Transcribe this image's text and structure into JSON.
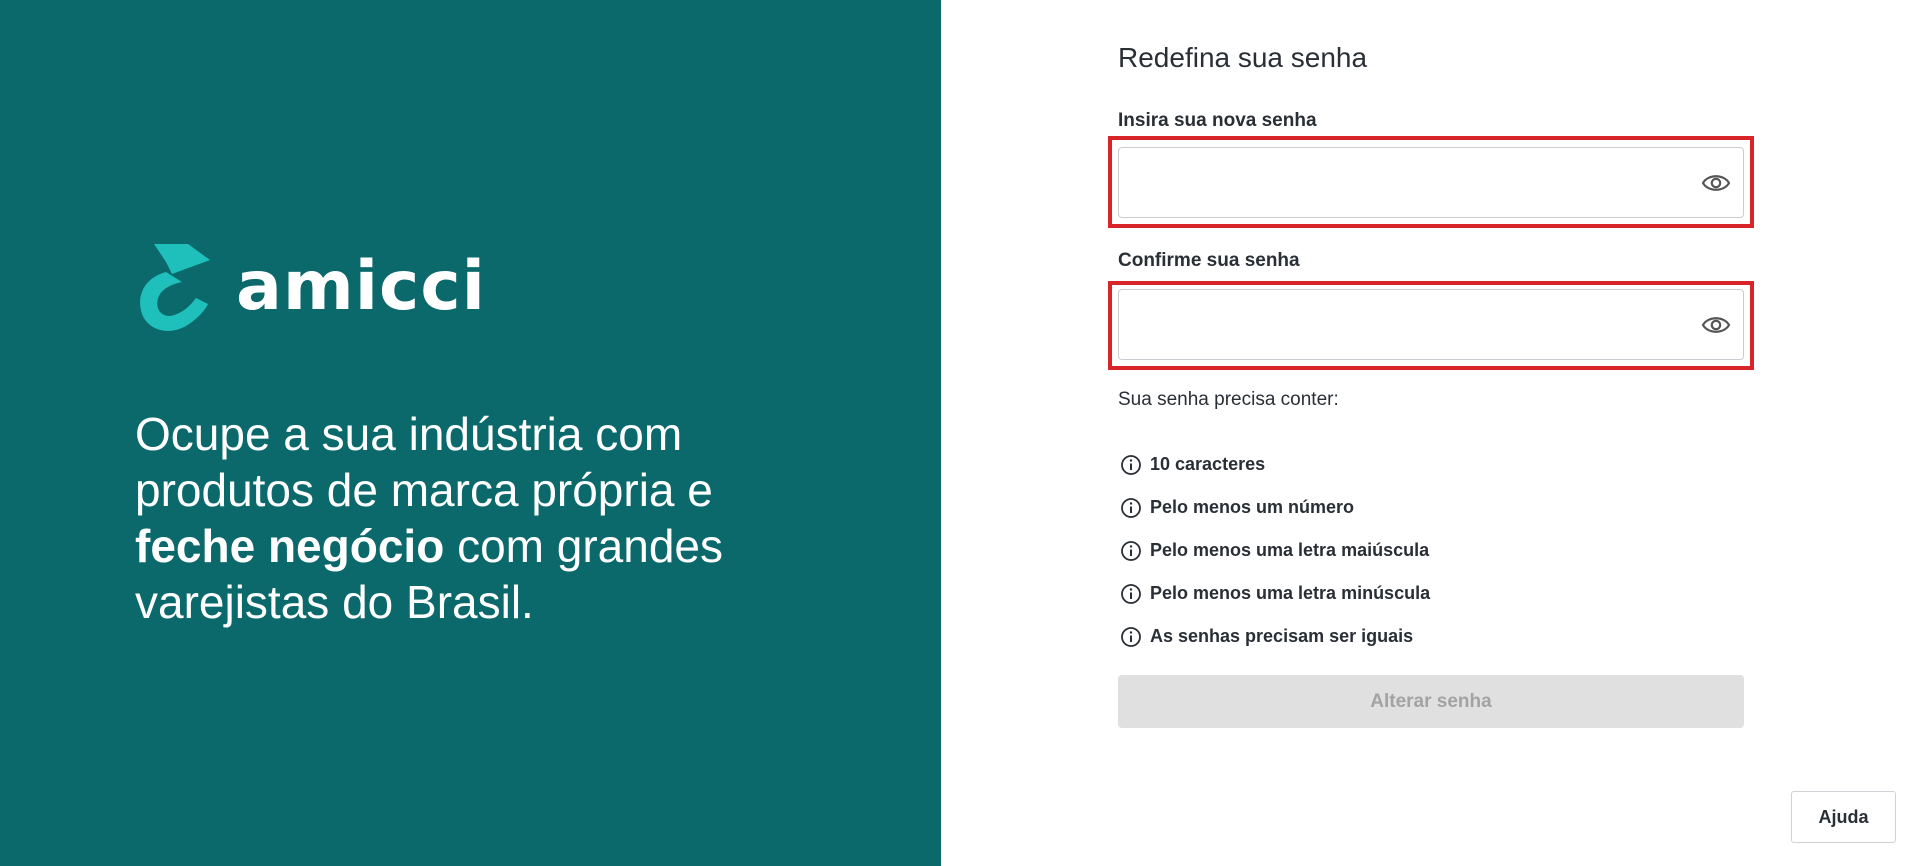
{
  "brand": {
    "name": "amicci",
    "colors": {
      "panel": "#0b686b",
      "logo_mark": "#1fc0bb",
      "highlight": "#d9252a"
    }
  },
  "hero": {
    "line1": "Ocupe a sua indústria com",
    "line2": "produtos de marca própria e",
    "bold": "feche negócio",
    "line3_rest": " com grandes",
    "line4": "varejistas do Brasil."
  },
  "form": {
    "title": "Redefina sua senha",
    "new_password": {
      "label": "Insira sua nova senha",
      "value": "",
      "icon": "eye-icon"
    },
    "confirm_password": {
      "label": "Confirme sua senha",
      "value": "",
      "icon": "eye-icon"
    },
    "requirements_title": "Sua senha precisa conter:",
    "requirements": [
      {
        "icon": "info-icon",
        "text": "10 caracteres"
      },
      {
        "icon": "info-icon",
        "text": "Pelo menos um número"
      },
      {
        "icon": "info-icon",
        "text": "Pelo menos uma letra maiúscula"
      },
      {
        "icon": "info-icon",
        "text": "Pelo menos uma letra minúscula"
      },
      {
        "icon": "info-icon",
        "text": "As senhas precisam ser iguais"
      }
    ],
    "submit_label": "Alterar senha"
  },
  "help_label": "Ajuda"
}
